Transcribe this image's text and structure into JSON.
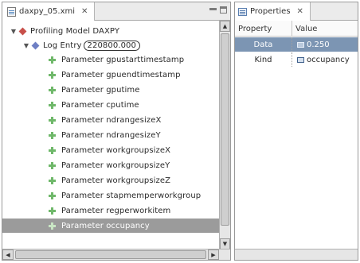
{
  "editor": {
    "tab_title": "daxpy_05.xmi",
    "tab_close": "✕",
    "tree": {
      "root": {
        "label": "Profiling Model DAXPY",
        "expanded": true
      },
      "entry": {
        "prefix": "Log Entry",
        "value": "220800.000",
        "expanded": true
      },
      "params": [
        "Parameter gpustarttimestamp",
        "Parameter gpuendtimestamp",
        "Parameter gputime",
        "Parameter cputime",
        "Parameter ndrangesizeX",
        "Parameter ndrangesizeY",
        "Parameter workgroupsizeX",
        "Parameter workgroupsizeY",
        "Parameter workgroupsizeZ",
        "Parameter stapmemperworkgroup",
        "Parameter regperworkitem",
        "Parameter occupancy"
      ],
      "selected_param": "Parameter occupancy"
    },
    "scroll_up": "▲",
    "scroll_down": "▼",
    "scroll_left": "◀",
    "scroll_right": "▶"
  },
  "properties": {
    "tab_title": "Properties",
    "tab_close": "✕",
    "columns": {
      "property": "Property",
      "value": "Value"
    },
    "rows": [
      {
        "property": "Data",
        "value": "0.250",
        "selected": true
      },
      {
        "property": "Kind",
        "value": "occupancy",
        "selected": false
      }
    ]
  },
  "colors": {
    "selection_gray": "#9b9b9b",
    "selection_blue": "#7c95b3",
    "param_green": "#6fb86a",
    "root_red": "#c8504a",
    "entry_blue": "#6e7fc4"
  }
}
